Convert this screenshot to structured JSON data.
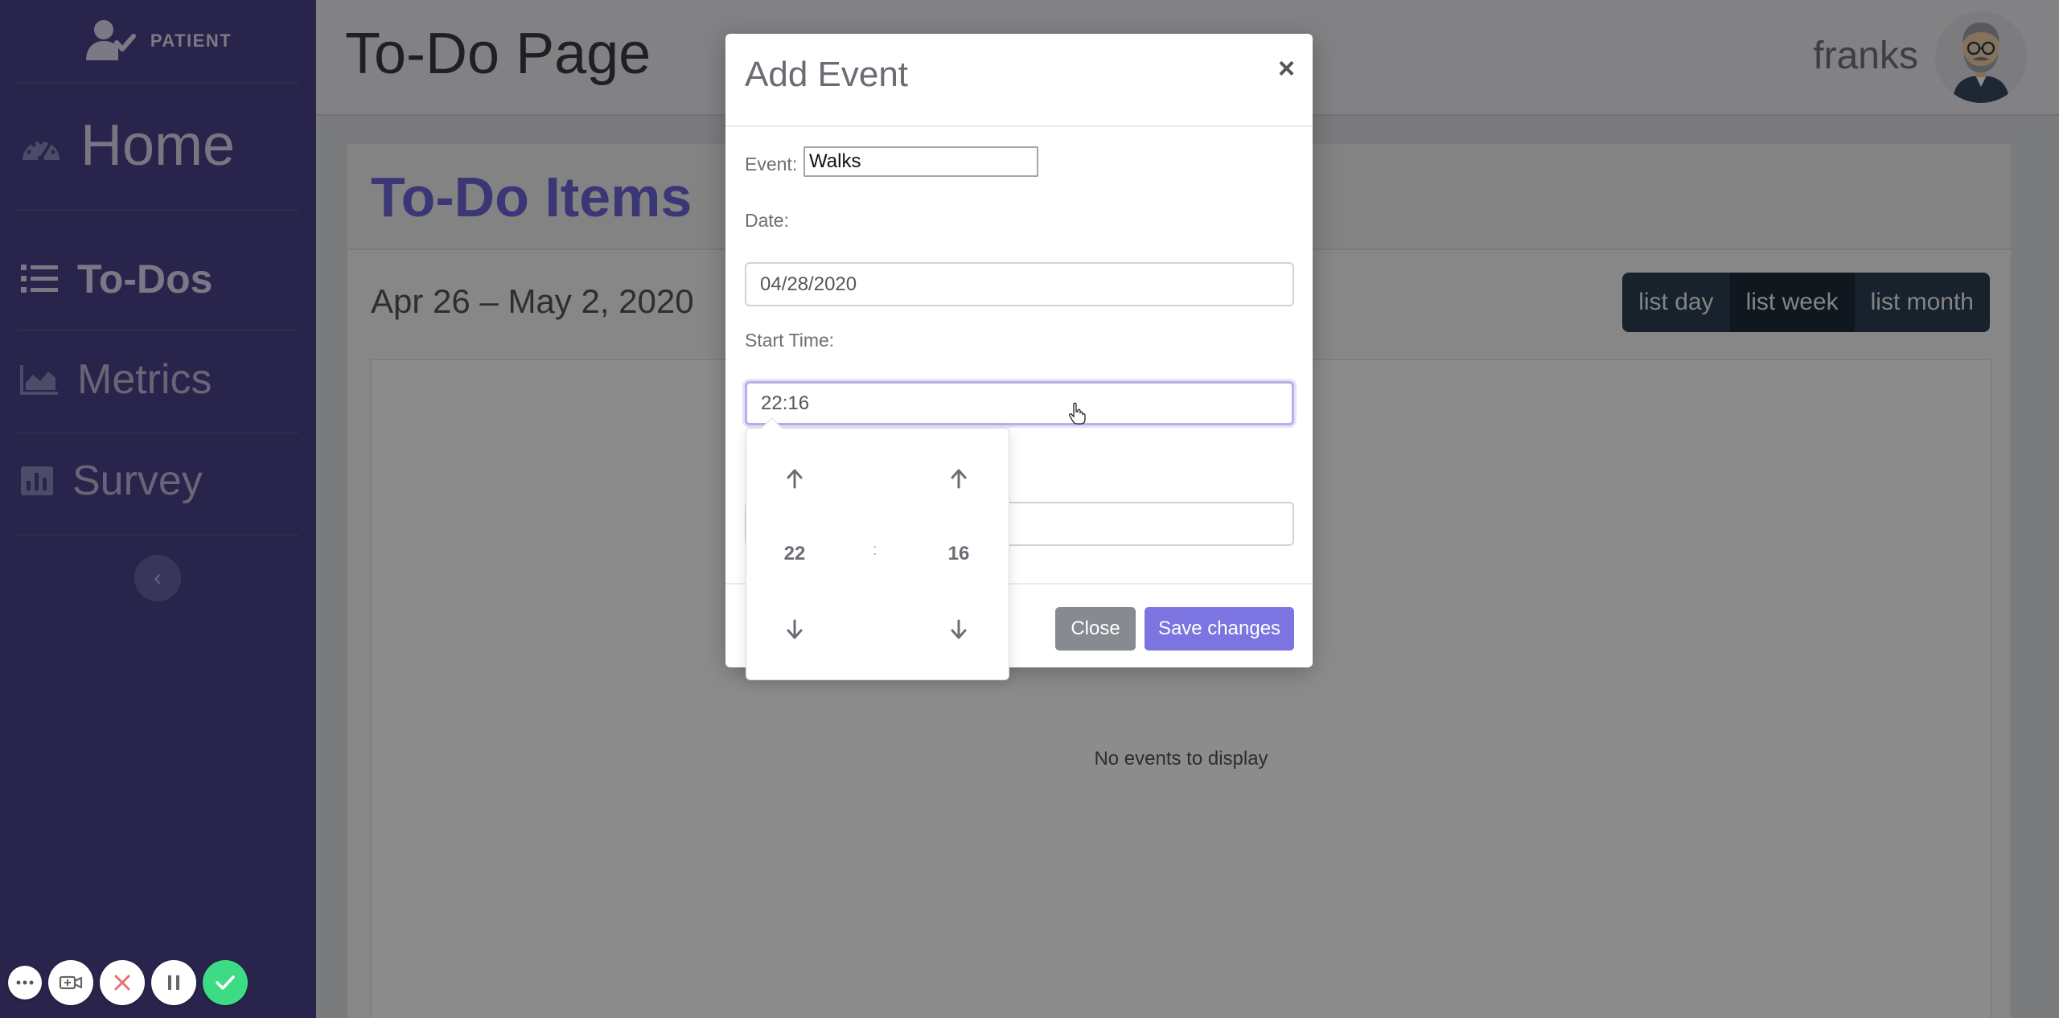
{
  "sidebar": {
    "brand_label": "PATIENT",
    "items": [
      {
        "key": "home",
        "label": "Home",
        "icon": "gauge-icon"
      },
      {
        "key": "todos",
        "label": "To-Dos",
        "icon": "list-icon"
      },
      {
        "key": "metrics",
        "label": "Metrics",
        "icon": "area-chart-icon"
      },
      {
        "key": "survey",
        "label": "Survey",
        "icon": "bar-chart-icon"
      }
    ],
    "collapse_label": "‹"
  },
  "header": {
    "title": "To-Do Page",
    "username": "franks"
  },
  "card": {
    "title": "To-Do Items",
    "date_range": "Apr 26 – May 2, 2020",
    "views": [
      {
        "label": "list day",
        "active": false
      },
      {
        "label": "list week",
        "active": true
      },
      {
        "label": "list month",
        "active": false
      }
    ],
    "empty_message": "No events to display"
  },
  "modal": {
    "title": "Add Event",
    "close_symbol": "×",
    "event_label": "Event:",
    "event_value": "Walks",
    "date_label": "Date:",
    "date_value": "04/28/2020",
    "start_time_label": "Start Time:",
    "start_time_value": "22:16",
    "close_button": "Close",
    "save_button": "Save changes"
  },
  "timepicker": {
    "hour": "22",
    "minute": "16",
    "separator": ":"
  },
  "colors": {
    "sidebar_bg": "#4a428b",
    "accent": "#6c63d6",
    "save_button": "#7c74e0",
    "close_button": "#878a90",
    "view_button": "#2c3e50",
    "recording_confirm": "#3ddc84"
  },
  "recording_toolbar": [
    {
      "name": "more-icon"
    },
    {
      "name": "camera-icon"
    },
    {
      "name": "cancel-icon"
    },
    {
      "name": "pause-icon"
    },
    {
      "name": "confirm-icon"
    }
  ]
}
